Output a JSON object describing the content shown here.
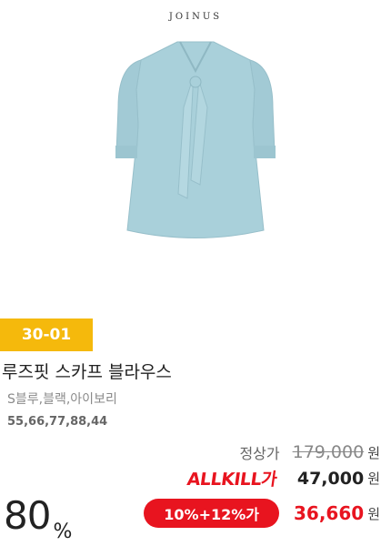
{
  "brand": "JOINUS",
  "product": {
    "code": "30-01",
    "title": "루즈핏 스카프 블라우스",
    "colors": "S블루,블랙,아이보리",
    "sizes": "55,66,77,88,44"
  },
  "pricing": {
    "regular_label": "정상가",
    "regular_price": "179,000",
    "allkill_logo": "ALLKILL가",
    "allkill_price": "47,000",
    "coupon_label": "10%+12%가",
    "final_price": "36,660",
    "currency": "원",
    "discount_number": "80",
    "discount_symbol": "%"
  },
  "colors": {
    "badge": "#f5b90c",
    "accent_red": "#e8141f",
    "blouse": "#a9d0da"
  },
  "icons": {
    "product_image": "blouse-photo"
  }
}
